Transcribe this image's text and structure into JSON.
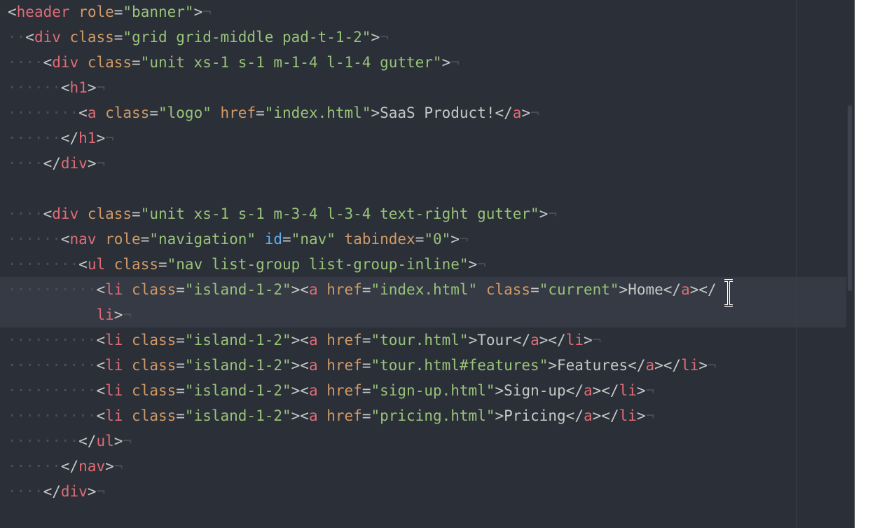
{
  "editor": {
    "language": "html",
    "lines": [
      {
        "indent": "",
        "parts": [
          [
            "pun",
            "<"
          ],
          [
            "tag",
            "header"
          ],
          [
            "txt",
            " "
          ],
          [
            "attr",
            "role"
          ],
          [
            "pun",
            "="
          ],
          [
            "str",
            "\"banner\""
          ],
          [
            "pun",
            ">"
          ]
        ]
      },
      {
        "indent": "··",
        "parts": [
          [
            "pun",
            "<"
          ],
          [
            "tag",
            "div"
          ],
          [
            "txt",
            " "
          ],
          [
            "attr",
            "class"
          ],
          [
            "pun",
            "="
          ],
          [
            "str",
            "\"grid grid-middle pad-t-1-2\""
          ],
          [
            "pun",
            ">"
          ]
        ]
      },
      {
        "indent": "····",
        "parts": [
          [
            "pun",
            "<"
          ],
          [
            "tag",
            "div"
          ],
          [
            "txt",
            " "
          ],
          [
            "attr",
            "class"
          ],
          [
            "pun",
            "="
          ],
          [
            "str",
            "\"unit xs-1 s-1 m-1-4 l-1-4 gutter\""
          ],
          [
            "pun",
            ">"
          ]
        ]
      },
      {
        "indent": "······",
        "parts": [
          [
            "pun",
            "<"
          ],
          [
            "tag",
            "h1"
          ],
          [
            "pun",
            ">"
          ]
        ]
      },
      {
        "indent": "········",
        "parts": [
          [
            "pun",
            "<"
          ],
          [
            "tag",
            "a"
          ],
          [
            "txt",
            " "
          ],
          [
            "attr",
            "class"
          ],
          [
            "pun",
            "="
          ],
          [
            "str",
            "\"logo\""
          ],
          [
            "txt",
            " "
          ],
          [
            "attr",
            "href"
          ],
          [
            "pun",
            "="
          ],
          [
            "str",
            "\"index.html\""
          ],
          [
            "pun",
            ">"
          ],
          [
            "txt",
            "SaaS Product!"
          ],
          [
            "pun",
            "</"
          ],
          [
            "tag",
            "a"
          ],
          [
            "pun",
            ">"
          ]
        ]
      },
      {
        "indent": "······",
        "parts": [
          [
            "pun",
            "</"
          ],
          [
            "tag",
            "h1"
          ],
          [
            "pun",
            ">"
          ]
        ]
      },
      {
        "indent": "····",
        "parts": [
          [
            "pun",
            "</"
          ],
          [
            "tag",
            "div"
          ],
          [
            "pun",
            ">"
          ]
        ]
      },
      {
        "indent": "",
        "parts": []
      },
      {
        "indent": "····",
        "parts": [
          [
            "pun",
            "<"
          ],
          [
            "tag",
            "div"
          ],
          [
            "txt",
            " "
          ],
          [
            "attr",
            "class"
          ],
          [
            "pun",
            "="
          ],
          [
            "str",
            "\"unit xs-1 s-1 m-3-4 l-3-4 text-right gutter\""
          ],
          [
            "pun",
            ">"
          ]
        ]
      },
      {
        "indent": "······",
        "parts": [
          [
            "pun",
            "<"
          ],
          [
            "tag",
            "nav"
          ],
          [
            "txt",
            " "
          ],
          [
            "attr",
            "role"
          ],
          [
            "pun",
            "="
          ],
          [
            "str",
            "\"navigation\""
          ],
          [
            "txt",
            " "
          ],
          [
            "attr-id",
            "id"
          ],
          [
            "pun",
            "="
          ],
          [
            "str",
            "\"nav\""
          ],
          [
            "txt",
            " "
          ],
          [
            "attr",
            "tabindex"
          ],
          [
            "pun",
            "="
          ],
          [
            "str",
            "\"0\""
          ],
          [
            "pun",
            ">"
          ]
        ]
      },
      {
        "indent": "········",
        "parts": [
          [
            "pun",
            "<"
          ],
          [
            "tag",
            "ul"
          ],
          [
            "txt",
            " "
          ],
          [
            "attr",
            "class"
          ],
          [
            "pun",
            "="
          ],
          [
            "str",
            "\"nav list-group list-group-inline\""
          ],
          [
            "pun",
            ">"
          ]
        ]
      },
      {
        "indent": "··········",
        "highlight": true,
        "parts": [
          [
            "pun",
            "<"
          ],
          [
            "tag",
            "li"
          ],
          [
            "txt",
            " "
          ],
          [
            "attr",
            "class"
          ],
          [
            "pun",
            "="
          ],
          [
            "str",
            "\"island-1-2\""
          ],
          [
            "pun",
            "><"
          ],
          [
            "tag",
            "a"
          ],
          [
            "txt",
            " "
          ],
          [
            "attr",
            "href"
          ],
          [
            "pun",
            "="
          ],
          [
            "str",
            "\"index.html\""
          ],
          [
            "txt",
            " "
          ],
          [
            "attr",
            "class"
          ],
          [
            "pun",
            "="
          ],
          [
            "str",
            "\"current\""
          ],
          [
            "pun",
            ">"
          ],
          [
            "txt",
            "Home"
          ],
          [
            "pun",
            "</"
          ],
          [
            "tag",
            "a"
          ],
          [
            "pun",
            "></"
          ]
        ]
      },
      {
        "indent": "          ",
        "highlight": true,
        "parts": [
          [
            "tag",
            "li"
          ],
          [
            "pun",
            ">"
          ]
        ]
      },
      {
        "indent": "··········",
        "parts": [
          [
            "pun",
            "<"
          ],
          [
            "tag",
            "li"
          ],
          [
            "txt",
            " "
          ],
          [
            "attr",
            "class"
          ],
          [
            "pun",
            "="
          ],
          [
            "str",
            "\"island-1-2\""
          ],
          [
            "pun",
            "><"
          ],
          [
            "tag",
            "a"
          ],
          [
            "txt",
            " "
          ],
          [
            "attr",
            "href"
          ],
          [
            "pun",
            "="
          ],
          [
            "str",
            "\"tour.html\""
          ],
          [
            "pun",
            ">"
          ],
          [
            "txt",
            "Tour"
          ],
          [
            "pun",
            "</"
          ],
          [
            "tag",
            "a"
          ],
          [
            "pun",
            "></"
          ],
          [
            "tag",
            "li"
          ],
          [
            "pun",
            ">"
          ]
        ]
      },
      {
        "indent": "··········",
        "parts": [
          [
            "pun",
            "<"
          ],
          [
            "tag",
            "li"
          ],
          [
            "txt",
            " "
          ],
          [
            "attr",
            "class"
          ],
          [
            "pun",
            "="
          ],
          [
            "str",
            "\"island-1-2\""
          ],
          [
            "pun",
            "><"
          ],
          [
            "tag",
            "a"
          ],
          [
            "txt",
            " "
          ],
          [
            "attr",
            "href"
          ],
          [
            "pun",
            "="
          ],
          [
            "str",
            "\"tour.html#features\""
          ],
          [
            "pun",
            ">"
          ],
          [
            "txt",
            "Features"
          ],
          [
            "pun",
            "</"
          ],
          [
            "tag",
            "a"
          ],
          [
            "pun",
            "></"
          ],
          [
            "tag",
            "li"
          ],
          [
            "pun",
            ">"
          ]
        ]
      },
      {
        "indent": "··········",
        "parts": [
          [
            "pun",
            "<"
          ],
          [
            "tag",
            "li"
          ],
          [
            "txt",
            " "
          ],
          [
            "attr",
            "class"
          ],
          [
            "pun",
            "="
          ],
          [
            "str",
            "\"island-1-2\""
          ],
          [
            "pun",
            "><"
          ],
          [
            "tag",
            "a"
          ],
          [
            "txt",
            " "
          ],
          [
            "attr",
            "href"
          ],
          [
            "pun",
            "="
          ],
          [
            "str",
            "\"sign-up.html\""
          ],
          [
            "pun",
            ">"
          ],
          [
            "txt",
            "Sign-up"
          ],
          [
            "pun",
            "</"
          ],
          [
            "tag",
            "a"
          ],
          [
            "pun",
            "></"
          ],
          [
            "tag",
            "li"
          ],
          [
            "pun",
            ">"
          ]
        ]
      },
      {
        "indent": "··········",
        "parts": [
          [
            "pun",
            "<"
          ],
          [
            "tag",
            "li"
          ],
          [
            "txt",
            " "
          ],
          [
            "attr",
            "class"
          ],
          [
            "pun",
            "="
          ],
          [
            "str",
            "\"island-1-2\""
          ],
          [
            "pun",
            "><"
          ],
          [
            "tag",
            "a"
          ],
          [
            "txt",
            " "
          ],
          [
            "attr",
            "href"
          ],
          [
            "pun",
            "="
          ],
          [
            "str",
            "\"pricing.html\""
          ],
          [
            "pun",
            ">"
          ],
          [
            "txt",
            "Pricing"
          ],
          [
            "pun",
            "</"
          ],
          [
            "tag",
            "a"
          ],
          [
            "pun",
            "></"
          ],
          [
            "tag",
            "li"
          ],
          [
            "pun",
            ">"
          ]
        ]
      },
      {
        "indent": "········",
        "parts": [
          [
            "pun",
            "</"
          ],
          [
            "tag",
            "ul"
          ],
          [
            "pun",
            ">"
          ]
        ]
      },
      {
        "indent": "······",
        "parts": [
          [
            "pun",
            "</"
          ],
          [
            "tag",
            "nav"
          ],
          [
            "pun",
            ">"
          ]
        ]
      },
      {
        "indent": "····",
        "parts": [
          [
            "pun",
            "</"
          ],
          [
            "tag",
            "div"
          ],
          [
            "pun",
            ">"
          ]
        ]
      }
    ],
    "colors": {
      "background": "#2b2f38",
      "tag": "#e06c75",
      "attribute": "#d19a66",
      "string": "#98c379",
      "text": "#c5c8c6",
      "id_attribute": "#61afef"
    },
    "cursor_icon": "i-beam-cursor-icon"
  }
}
